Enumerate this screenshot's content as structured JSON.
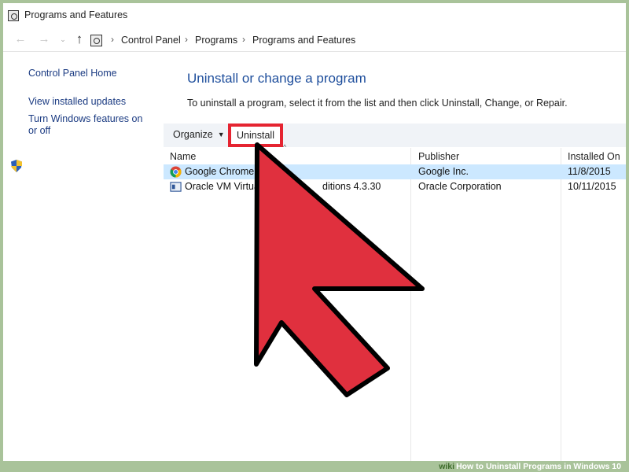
{
  "window": {
    "title": "Programs and Features"
  },
  "address": {
    "crumbs": [
      "Control Panel",
      "Programs",
      "Programs and Features"
    ],
    "separator": "›"
  },
  "nav": {
    "back": "←",
    "forward": "→",
    "history": "⌄",
    "up": "↑"
  },
  "left_pane": {
    "links": [
      "Control Panel Home",
      "View installed updates",
      "Turn Windows features on or off"
    ]
  },
  "main": {
    "title": "Uninstall or change a program",
    "description": "To uninstall a program, select it from the list and then click Uninstall, Change, or Repair."
  },
  "toolbar": {
    "organize_label": "Organize",
    "organize_caret": "▼",
    "uninstall_label": "Uninstall",
    "highlight_color": "#e52431"
  },
  "table": {
    "sort_caret": "^",
    "columns": [
      "Name",
      "Publisher",
      "Installed On"
    ],
    "rows": [
      {
        "name": "Google Chrome",
        "publisher": "Google Inc.",
        "installed_on": "11/8/2015",
        "icon": "chrome-icon",
        "selected": true
      },
      {
        "name": "Oracle VM Virtual",
        "name_tail": "ditions 4.3.30",
        "publisher": "Oracle Corporation",
        "installed_on": "10/11/2015",
        "icon": "virtualbox-icon",
        "selected": false
      }
    ]
  },
  "overlay": {
    "arrow_color": "#e0303e"
  },
  "caption": {
    "brand": "wiki",
    "text": "How to Uninstall Programs in Windows 10"
  }
}
